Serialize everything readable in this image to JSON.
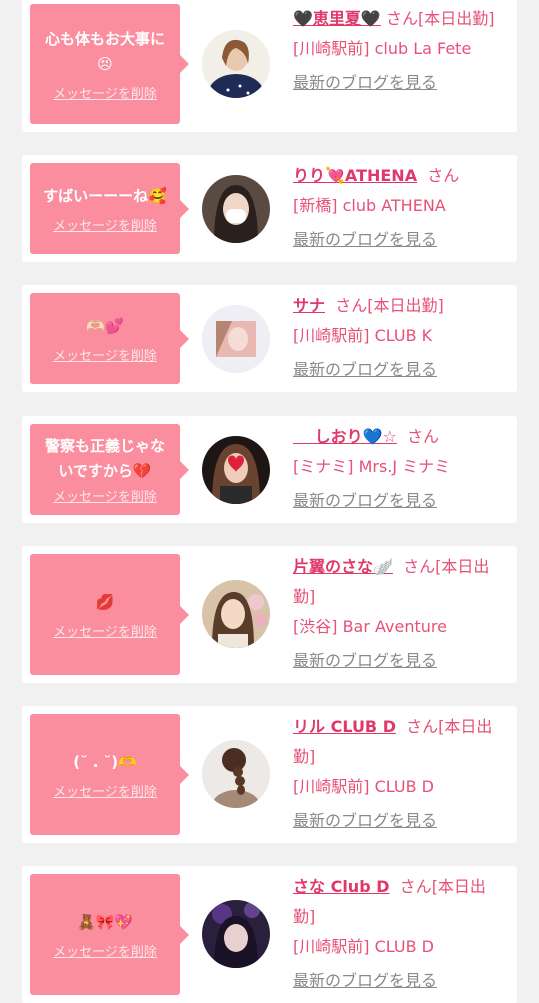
{
  "delete_label": "メッセージを削除",
  "blog_label": "最新のブログを見る",
  "san": "さん",
  "entries": [
    {
      "message_lines": [
        "心も体もお大事に",
        "😣"
      ],
      "name": "🖤恵里夏🖤",
      "status": "[本日出勤]",
      "shop": "[川崎駅前] club La Fete",
      "avatar": "woman-in-navy-top"
    },
    {
      "message_lines": [
        "すばいーーーね🥰"
      ],
      "name": "りり💘ATHENA",
      "status": "",
      "shop": "[新橋] club ATHENA",
      "avatar": "woman-with-mask"
    },
    {
      "message_lines": [
        "🫶🏻💕"
      ],
      "name": "サナ",
      "status": "[本日出勤]",
      "shop": "[川崎駅前] CLUB K",
      "avatar": "blurred-portrait"
    },
    {
      "message_lines": [
        "警察も正義じゃな",
        "いですから💔"
      ],
      "name": "　 しおり💙☆",
      "status": "",
      "shop": "[ミナミ] Mrs.J ミナミ",
      "avatar": "woman-with-heart-sticker"
    },
    {
      "message_lines": [
        "💋"
      ],
      "name": "片翼のさな🪽",
      "status": "[本日出勤]",
      "shop": "[渋谷] Bar Aventure",
      "avatar": "woman-with-flowers"
    },
    {
      "message_lines": [
        "(˘ . ˘)🫶"
      ],
      "name": "リル CLUB D",
      "status": "[本日出勤]",
      "shop": "[川崎駅前] CLUB D",
      "avatar": "braided-hair-back"
    },
    {
      "message_lines": [
        "🧸🎀💖"
      ],
      "name": "さな Club D",
      "status": "[本日出勤]",
      "shop": "[川崎駅前] CLUB D",
      "avatar": "woman-purple-light"
    }
  ],
  "colors": {
    "bubble": "#fa8d9e",
    "name": "#e0386a",
    "text": "#e85078",
    "link": "#8a8a8a",
    "background": "#f1f1f1"
  }
}
